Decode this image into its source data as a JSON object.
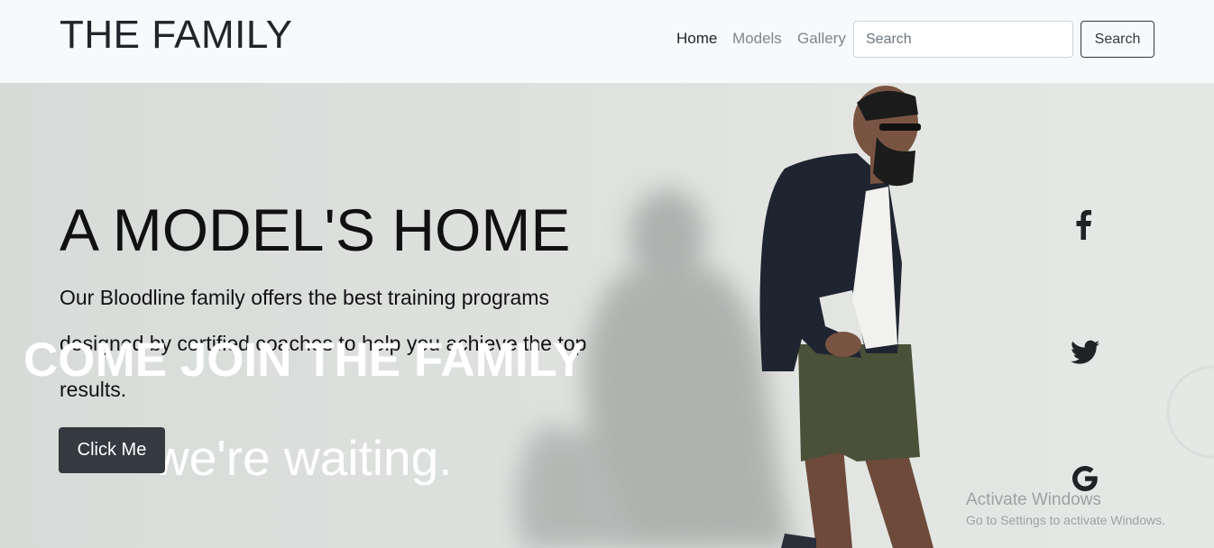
{
  "navbar": {
    "brand": "THE FAMILY",
    "links": [
      {
        "label": "Home",
        "active": true
      },
      {
        "label": "Models",
        "active": false
      },
      {
        "label": "Gallery",
        "active": false
      }
    ],
    "search": {
      "placeholder": "Search",
      "value": "",
      "button_label": "Search"
    }
  },
  "hero": {
    "title": "A MODEL'S HOME",
    "text": "Our Bloodline family offers the best training programs designed by certified coaches to help you achieve the top results.",
    "button_label": "Click Me",
    "overlay_title": "COME JOIN THE FAMILY",
    "overlay_subtitle": "we're waiting."
  },
  "social": [
    {
      "icon": "facebook-icon"
    },
    {
      "icon": "twitter-icon"
    },
    {
      "icon": "google-icon"
    }
  ],
  "watermark": {
    "title": "Activate Windows",
    "subtitle": "Go to Settings to activate Windows."
  },
  "colors": {
    "navbar_bg": "#f8f9fa",
    "button_dark": "#343a40",
    "hero_bg": "#dde0dd"
  }
}
